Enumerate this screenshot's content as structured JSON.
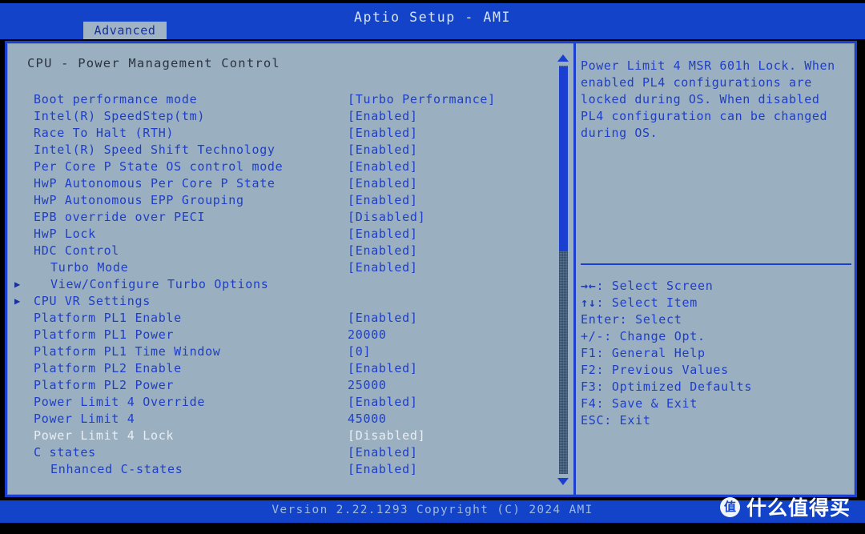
{
  "app": {
    "title": "Aptio Setup - AMI",
    "footer": "Version 2.22.1293 Copyright (C) 2024 AMI"
  },
  "tabs": [
    {
      "label": "Advanced",
      "active": true
    }
  ],
  "main": {
    "section_title": "CPU - Power Management Control",
    "rows": [
      {
        "label": "Boot performance mode",
        "value": "[Turbo Performance]",
        "indent": 1,
        "submenu": false,
        "selected": false
      },
      {
        "label": "Intel(R) SpeedStep(tm)",
        "value": "[Enabled]",
        "indent": 1,
        "submenu": false,
        "selected": false
      },
      {
        "label": "Race To Halt (RTH)",
        "value": "[Enabled]",
        "indent": 1,
        "submenu": false,
        "selected": false
      },
      {
        "label": "Intel(R) Speed Shift Technology",
        "value": "[Enabled]",
        "indent": 1,
        "submenu": false,
        "selected": false
      },
      {
        "label": "Per Core P State OS control mode",
        "value": "[Enabled]",
        "indent": 1,
        "submenu": false,
        "selected": false
      },
      {
        "label": "HwP Autonomous Per Core P State",
        "value": "[Enabled]",
        "indent": 1,
        "submenu": false,
        "selected": false
      },
      {
        "label": "HwP Autonomous EPP Grouping",
        "value": "[Enabled]",
        "indent": 1,
        "submenu": false,
        "selected": false
      },
      {
        "label": "EPB override over PECI",
        "value": "[Disabled]",
        "indent": 1,
        "submenu": false,
        "selected": false
      },
      {
        "label": "HwP Lock",
        "value": "[Enabled]",
        "indent": 1,
        "submenu": false,
        "selected": false
      },
      {
        "label": "HDC Control",
        "value": "[Enabled]",
        "indent": 1,
        "submenu": false,
        "selected": false
      },
      {
        "label": "Turbo Mode",
        "value": "[Enabled]",
        "indent": 2,
        "submenu": false,
        "selected": false
      },
      {
        "label": "View/Configure Turbo Options",
        "value": "",
        "indent": 2,
        "submenu": true,
        "selected": false
      },
      {
        "label": "CPU VR Settings",
        "value": "",
        "indent": 1,
        "submenu": true,
        "selected": false
      },
      {
        "label": "Platform PL1 Enable",
        "value": "[Enabled]",
        "indent": 1,
        "submenu": false,
        "selected": false
      },
      {
        "label": "Platform PL1 Power",
        "value": "20000",
        "indent": 1,
        "submenu": false,
        "selected": false
      },
      {
        "label": "Platform PL1 Time Window",
        "value": "[0]",
        "indent": 1,
        "submenu": false,
        "selected": false
      },
      {
        "label": "Platform PL2 Enable",
        "value": "[Enabled]",
        "indent": 1,
        "submenu": false,
        "selected": false
      },
      {
        "label": "Platform PL2 Power",
        "value": "25000",
        "indent": 1,
        "submenu": false,
        "selected": false
      },
      {
        "label": "Power Limit 4 Override",
        "value": "[Enabled]",
        "indent": 1,
        "submenu": false,
        "selected": false
      },
      {
        "label": "Power Limit 4",
        "value": "45000",
        "indent": 1,
        "submenu": false,
        "selected": false
      },
      {
        "label": "Power Limit 4 Lock",
        "value": "[Disabled]",
        "indent": 1,
        "submenu": false,
        "selected": true
      },
      {
        "label": "C states",
        "value": "[Enabled]",
        "indent": 1,
        "submenu": false,
        "selected": false
      },
      {
        "label": "Enhanced C-states",
        "value": "[Enabled]",
        "indent": 2,
        "submenu": false,
        "selected": false
      }
    ]
  },
  "scrollbar": {
    "up_arrow": "scroll-up-arrow",
    "down_arrow": "scroll-down-arrow"
  },
  "help": {
    "text": "Power Limit 4 MSR 601h Lock. When enabled PL4 configurations are locked during OS. When disabled PL4 configuration can be changed during OS.",
    "keys": [
      {
        "glyph": "→←",
        "text": ": Select Screen"
      },
      {
        "glyph": "↑↓",
        "text": ": Select Item"
      },
      {
        "glyph": "",
        "text": "Enter: Select"
      },
      {
        "glyph": "",
        "text": "+/-: Change Opt."
      },
      {
        "glyph": "",
        "text": "F1: General Help"
      },
      {
        "glyph": "",
        "text": "F2: Previous Values"
      },
      {
        "glyph": "",
        "text": "F3: Optimized Defaults"
      },
      {
        "glyph": "",
        "text": "F4: Save & Exit"
      },
      {
        "glyph": "",
        "text": "ESC: Exit"
      }
    ]
  },
  "watermark": {
    "logo_char": "值",
    "text": "什么值得买"
  },
  "colors": {
    "title_bar": "#1243c8",
    "panel_bg": "#9aafbf",
    "border": "#1b3fd0",
    "text_blue": "#1e3ec8",
    "text_selected": "#e8eef5",
    "title_text": "#2b3442"
  }
}
